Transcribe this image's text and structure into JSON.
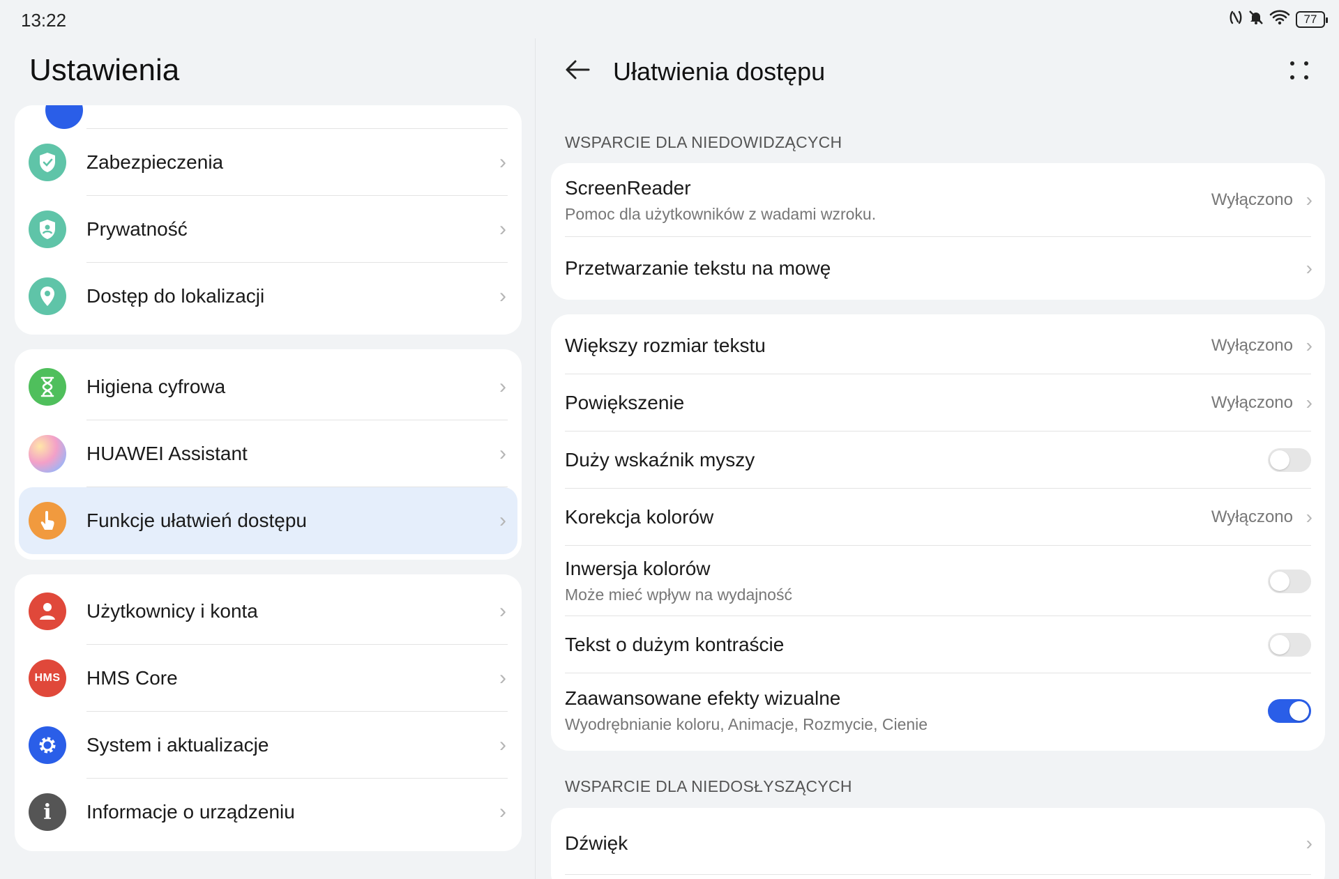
{
  "status_bar": {
    "time": "13:22",
    "battery": "77",
    "icons": [
      "nfc-icon",
      "mute-icon",
      "wifi-icon",
      "battery-icon"
    ]
  },
  "left": {
    "title": "Ustawienia",
    "groups": [
      {
        "items": [
          {
            "label": "Zabezpieczenia",
            "icon": "shield-icon",
            "color": "#5fc4a8"
          },
          {
            "label": "Prywatność",
            "icon": "privacy-icon",
            "color": "#5fc4a8"
          },
          {
            "label": "Dostęp do lokalizacji",
            "icon": "location-icon",
            "color": "#5fc4a8"
          }
        ]
      },
      {
        "items": [
          {
            "label": "Higiena cyfrowa",
            "icon": "hourglass-icon",
            "color": "#4fbf5c"
          },
          {
            "label": "HUAWEI Assistant",
            "icon": "assistant-icon",
            "color": "#d9a8f0"
          },
          {
            "label": "Funkcje ułatwień dostępu",
            "icon": "hand-icon",
            "color": "#f19a3e",
            "active": true
          }
        ]
      },
      {
        "items": [
          {
            "label": "Użytkownicy i konta",
            "icon": "user-icon",
            "color": "#e0483a"
          },
          {
            "label": "HMS Core",
            "icon": "hms-icon",
            "color": "#e0483a",
            "badge": "HMS"
          },
          {
            "label": "System i aktualizacje",
            "icon": "gear-icon",
            "color": "#2a5ee8"
          },
          {
            "label": "Informacje o urządzeniu",
            "icon": "info-icon",
            "color": "#555555"
          }
        ]
      }
    ]
  },
  "right": {
    "title": "Ułatwienia dostępu",
    "section_vision": "WSPARCIE DLA NIEDOWIDZĄCYCH",
    "group1": [
      {
        "title": "ScreenReader",
        "subtitle": "Pomoc dla użytkowników z wadami wzroku.",
        "value": "Wyłączono",
        "type": "link"
      },
      {
        "title": "Przetwarzanie tekstu na mowę",
        "type": "link"
      }
    ],
    "group2": [
      {
        "title": "Większy rozmiar tekstu",
        "value": "Wyłączono",
        "type": "link"
      },
      {
        "title": "Powiększenie",
        "value": "Wyłączono",
        "type": "link"
      },
      {
        "title": "Duży wskaźnik myszy",
        "type": "toggle",
        "on": false
      },
      {
        "title": "Korekcja kolorów",
        "value": "Wyłączono",
        "type": "link"
      },
      {
        "title": "Inwersja kolorów",
        "subtitle": "Może mieć wpływ na wydajność",
        "type": "toggle",
        "on": false
      },
      {
        "title": "Tekst o dużym kontraście",
        "type": "toggle",
        "on": false
      },
      {
        "title": "Zaawansowane efekty wizualne",
        "subtitle": "Wyodrębnianie koloru, Animacje, Rozmycie, Cienie",
        "type": "toggle",
        "on": true
      }
    ],
    "section_hearing": "WSPARCIE DLA NIEDOSŁYSZĄCYCH",
    "group3": [
      {
        "title": "Dźwięk",
        "type": "link"
      }
    ]
  }
}
